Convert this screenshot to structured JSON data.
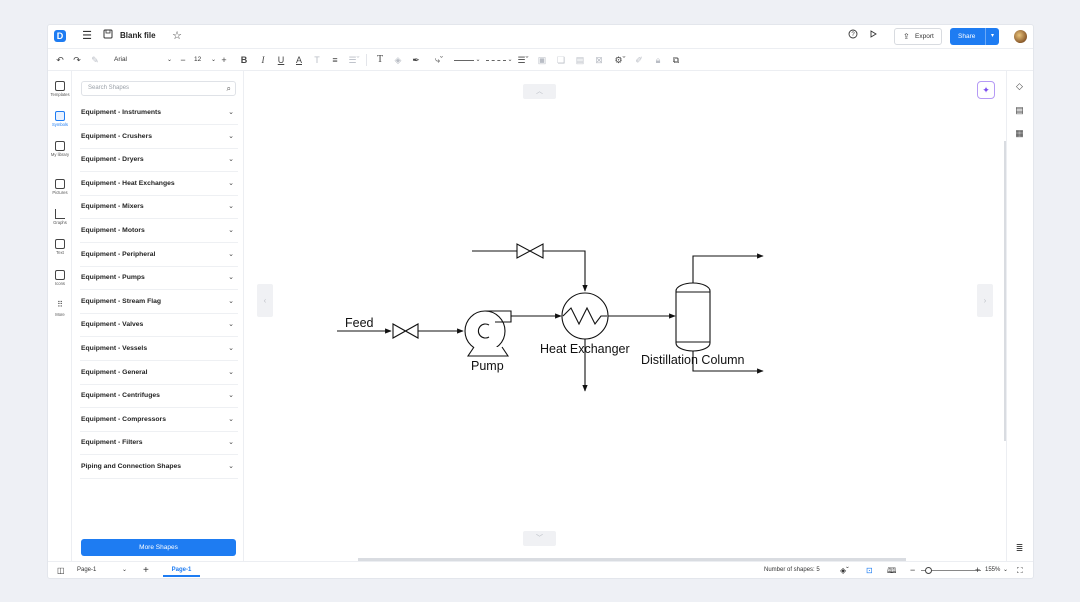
{
  "header": {
    "logo_letter": "D",
    "file_name": "Blank file",
    "export_label": "Export",
    "share_label": "Share"
  },
  "toolbar": {
    "font_family": "Arial",
    "font_size": "12"
  },
  "rail": {
    "items": [
      {
        "label": "Templates",
        "icon": "templates-icon"
      },
      {
        "label": "Symbols",
        "icon": "symbols-icon"
      },
      {
        "label": "My library",
        "icon": "library-icon"
      },
      {
        "label": "Pictures",
        "icon": "pictures-icon"
      },
      {
        "label": "Graphs",
        "icon": "graphs-icon"
      },
      {
        "label": "Text",
        "icon": "text-icon"
      },
      {
        "label": "Icons",
        "icon": "icons-icon"
      },
      {
        "label": "More",
        "icon": "more-icon"
      }
    ]
  },
  "panel": {
    "search_placeholder": "Search Shapes",
    "categories": [
      "Equipment - Instruments",
      "Equipment - Crushers",
      "Equipment - Dryers",
      "Equipment - Heat Exchanges",
      "Equipment - Mixers",
      "Equipment - Motors",
      "Equipment - Peripheral",
      "Equipment - Pumps",
      "Equipment - Stream Flag",
      "Equipment - Valves",
      "Equipment - Vessels",
      "Equipment - General",
      "Equipment - Centrifuges",
      "Equipment - Compressors",
      "Equipment - Filters",
      "Piping and Connection Shapes"
    ],
    "more_shapes_label": "More Shapes"
  },
  "diagram": {
    "labels": {
      "feed": "Feed",
      "pump": "Pump",
      "heat_exchanger": "Heat Exchanger",
      "distillation_column": "Distillation Column"
    }
  },
  "status": {
    "page_select": "Page-1",
    "page_tab": "Page-1",
    "shape_count_text": "Number of shapes: 5",
    "zoom_text": "155%"
  }
}
